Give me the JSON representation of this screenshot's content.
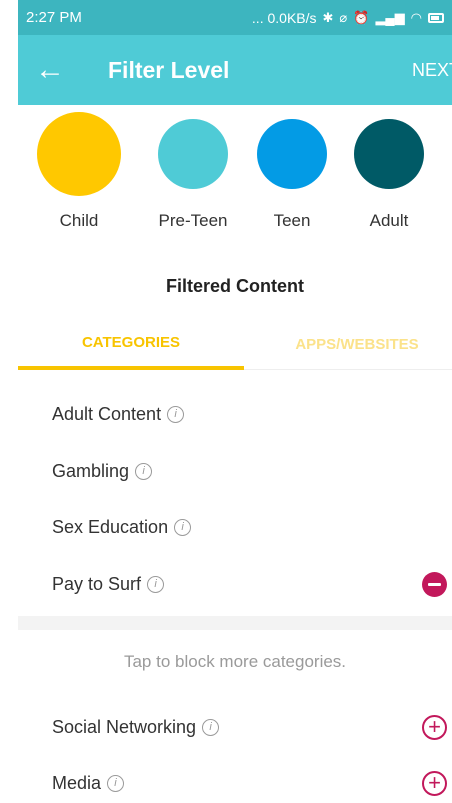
{
  "status_bar": {
    "time": "2:27 PM",
    "network_speed": "... 0.0KB/s",
    "icons": [
      "bluetooth-icon",
      "alarm-off-icon",
      "alarm-icon",
      "signal-icon",
      "wifi-icon",
      "battery-icon"
    ]
  },
  "app_bar": {
    "back_icon": "←",
    "title": "Filter Level",
    "next_label": "NEXT"
  },
  "levels": [
    {
      "label": "Child",
      "color": "#ffc800",
      "selected": true
    },
    {
      "label": "Pre-Teen",
      "color": "#4fcbd6",
      "selected": false
    },
    {
      "label": "Teen",
      "color": "#039be5",
      "selected": false
    },
    {
      "label": "Adult",
      "color": "#005a66",
      "selected": false
    }
  ],
  "section_title": "Filtered Content",
  "tabs": [
    {
      "label": "CATEGORIES",
      "active": true
    },
    {
      "label": "APPS/WEBSITES",
      "active": false
    }
  ],
  "blocked_categories": [
    {
      "label": "Adult Content",
      "removable": false
    },
    {
      "label": "Gambling",
      "removable": false
    },
    {
      "label": "Sex Education",
      "removable": false
    },
    {
      "label": "Pay to Surf",
      "removable": true
    }
  ],
  "hint": "Tap to block more categories.",
  "more_categories": [
    {
      "label": "Social Networking"
    },
    {
      "label": "Media"
    }
  ],
  "colors": {
    "status_bar": "#3db5bf",
    "app_bar": "#4fcbd6",
    "accent_tab": "#f8c400",
    "remove_button": "#c2185b"
  }
}
